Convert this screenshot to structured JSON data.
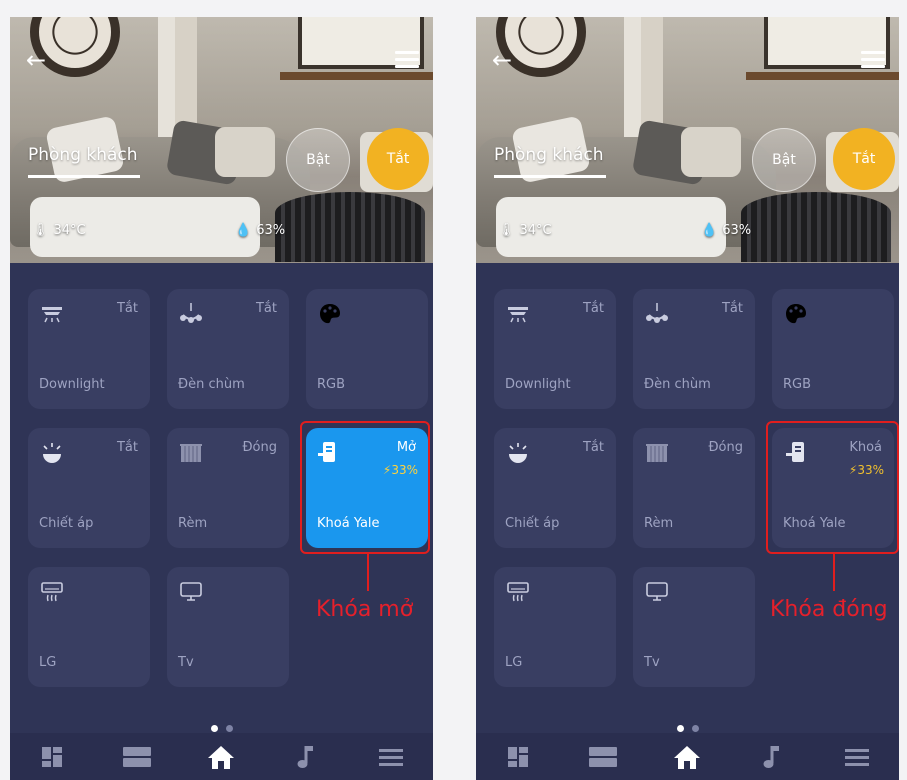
{
  "screens": [
    {
      "id": "left",
      "room": {
        "title": "Phòng khách",
        "on_label": "Bật",
        "off_label": "Tắt",
        "temperature": "34°C",
        "humidity": "63%"
      },
      "tiles": [
        {
          "name": "Downlight",
          "status": "Tắt",
          "icon": "downlight-icon"
        },
        {
          "name": "Đèn chùm",
          "status": "Tắt",
          "icon": "chandelier-icon"
        },
        {
          "name": "RGB",
          "status": "",
          "icon": "palette-icon"
        },
        {
          "name": "Chiết áp",
          "status": "Tắt",
          "icon": "dimmer-lamp-icon"
        },
        {
          "name": "Rèm",
          "status": "Đóng",
          "icon": "curtain-icon"
        },
        {
          "name": "Khoá Yale",
          "status": "Mở",
          "battery": "33%",
          "icon": "door-lock-icon",
          "active": true
        },
        {
          "name": "LG",
          "status": "",
          "icon": "air-conditioner-icon"
        },
        {
          "name": "Tv",
          "status": "",
          "icon": "tv-icon"
        }
      ],
      "callout_label": "Khóa mở"
    },
    {
      "id": "right",
      "room": {
        "title": "Phòng khách",
        "on_label": "Bật",
        "off_label": "Tắt",
        "temperature": "34°C",
        "humidity": "63%"
      },
      "tiles": [
        {
          "name": "Downlight",
          "status": "Tắt",
          "icon": "downlight-icon"
        },
        {
          "name": "Đèn chùm",
          "status": "Tắt",
          "icon": "chandelier-icon"
        },
        {
          "name": "RGB",
          "status": "",
          "icon": "palette-icon"
        },
        {
          "name": "Chiết áp",
          "status": "Tắt",
          "icon": "dimmer-lamp-icon"
        },
        {
          "name": "Rèm",
          "status": "Đóng",
          "icon": "curtain-icon"
        },
        {
          "name": "Khoá Yale",
          "status": "Khoá",
          "battery": "33%",
          "icon": "door-lock-icon",
          "active": false
        },
        {
          "name": "LG",
          "status": "",
          "icon": "air-conditioner-icon"
        },
        {
          "name": "Tv",
          "status": "",
          "icon": "tv-icon"
        }
      ],
      "callout_label": "Khóa đóng"
    }
  ],
  "bottom_nav": [
    "dashboard-icon",
    "scenes-icon",
    "home-icon",
    "music-icon",
    "menu-icon"
  ],
  "colors": {
    "background": "#2f3456",
    "tile": "#393e62",
    "tile_active": "#1a97ee",
    "off_button": "#f2b222",
    "callout": "#e01e1e",
    "battery": "#f2c12e"
  }
}
